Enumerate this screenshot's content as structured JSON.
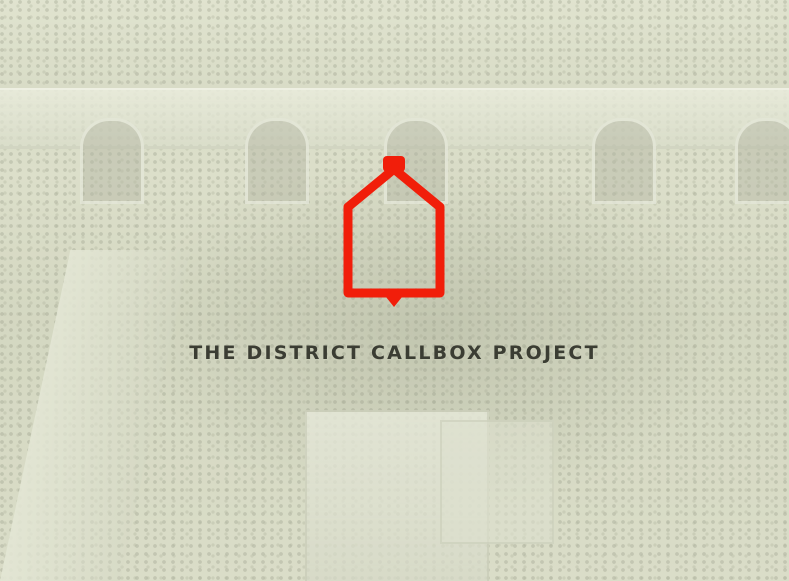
{
  "project": {
    "title": "THE DISTRICT CALLBOX PROJECT",
    "logo_icon": "callbox-house-outline-icon",
    "logo_color": "#f11e0a",
    "title_color": "#3b3d33"
  },
  "background": {
    "description_icon": "chamber-photo-backdrop",
    "tint": "#e3e6d1"
  }
}
